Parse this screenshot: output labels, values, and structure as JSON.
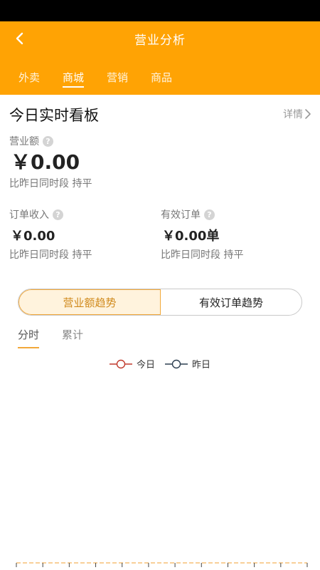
{
  "header": {
    "title": "营业分析",
    "tabs": [
      {
        "label": "外卖",
        "active": false
      },
      {
        "label": "商城",
        "active": true
      },
      {
        "label": "营销",
        "active": false
      },
      {
        "label": "商品",
        "active": false
      }
    ]
  },
  "board": {
    "title": "今日实时看板",
    "detail_label": "详情"
  },
  "metrics": {
    "revenue": {
      "label": "营业额",
      "value": "￥0.00",
      "compare": "比昨日同时段 持平"
    },
    "order_income": {
      "label": "订单收入",
      "value": "￥0.00",
      "compare": "比昨日同时段 持平"
    },
    "valid_orders": {
      "label": "有效订单",
      "value": "￥0.00单",
      "compare": "比昨日同时段 持平"
    }
  },
  "trend": {
    "segments": [
      {
        "label": "营业额趋势",
        "active": true
      },
      {
        "label": "有效订单趋势",
        "active": false
      }
    ],
    "sub_tabs": [
      {
        "label": "分时",
        "active": true
      },
      {
        "label": "累计",
        "active": false
      }
    ],
    "legend": [
      {
        "label": "今日",
        "color": "#c0392b"
      },
      {
        "label": "昨日",
        "color": "#2c3e50"
      }
    ]
  },
  "colors": {
    "brand": "#ffa304",
    "accent_orange": "#f2a83a",
    "baseline": "#f0a030"
  }
}
